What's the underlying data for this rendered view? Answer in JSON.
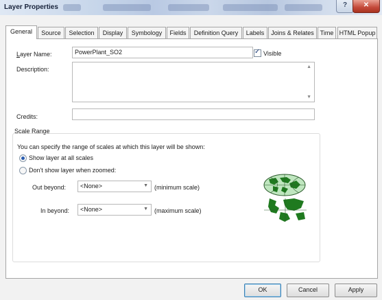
{
  "window": {
    "title": "Layer Properties",
    "help_glyph": "?",
    "close_glyph": "✕"
  },
  "tabs": [
    {
      "label": "General",
      "active": true
    },
    {
      "label": "Source"
    },
    {
      "label": "Selection"
    },
    {
      "label": "Display"
    },
    {
      "label": "Symbology"
    },
    {
      "label": "Fields"
    },
    {
      "label": "Definition Query"
    },
    {
      "label": "Labels"
    },
    {
      "label": "Joins & Relates"
    },
    {
      "label": "Time"
    },
    {
      "label": "HTML Popup"
    }
  ],
  "general": {
    "layer_name_label": "Layer Name:",
    "layer_name_value": "PowerPlant_SO2",
    "visible_label": "Visible",
    "visible_checked": true,
    "description_label": "Description:",
    "description_value": "",
    "credits_label": "Credits:",
    "credits_value": ""
  },
  "scale_range": {
    "group_label": "Scale Range",
    "instruction": "You can specify the range of scales at which this layer will be shown:",
    "option_show_all": "Show layer at all scales",
    "option_dont_show": "Don't show layer when zoomed:",
    "selected_option": "show_all",
    "out_beyond_label": "Out beyond:",
    "out_beyond_value": "<None>",
    "out_beyond_hint": "(minimum scale)",
    "in_beyond_label": "In beyond:",
    "in_beyond_value": "<None>",
    "in_beyond_hint": "(maximum scale)"
  },
  "buttons": {
    "ok": "OK",
    "cancel": "Cancel",
    "apply": "Apply"
  }
}
